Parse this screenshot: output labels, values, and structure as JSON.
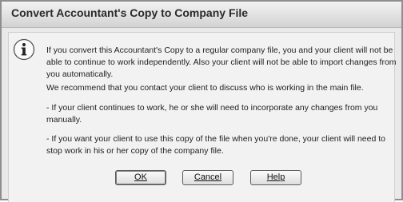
{
  "window": {
    "title": "Convert Accountant's Copy to Company File"
  },
  "message": {
    "icon": "info-icon",
    "paragraph1": "If you convert this Accountant's Copy to a regular company file, you and your client will not be able to continue to work independently.  Also your client will not be able to import changes from you automatically.",
    "paragraph2": "We recommend that you contact your client to discuss who is working in the main file.",
    "paragraph3": "- If your client continues to work, he or she will need to incorporate any changes from you manually.",
    "paragraph4": "- If you want your client to use this copy of the file when you're done, your client will need to stop work in his or her copy of the company file."
  },
  "buttons": {
    "ok": "OK",
    "cancel": "Cancel",
    "help": "Help"
  }
}
